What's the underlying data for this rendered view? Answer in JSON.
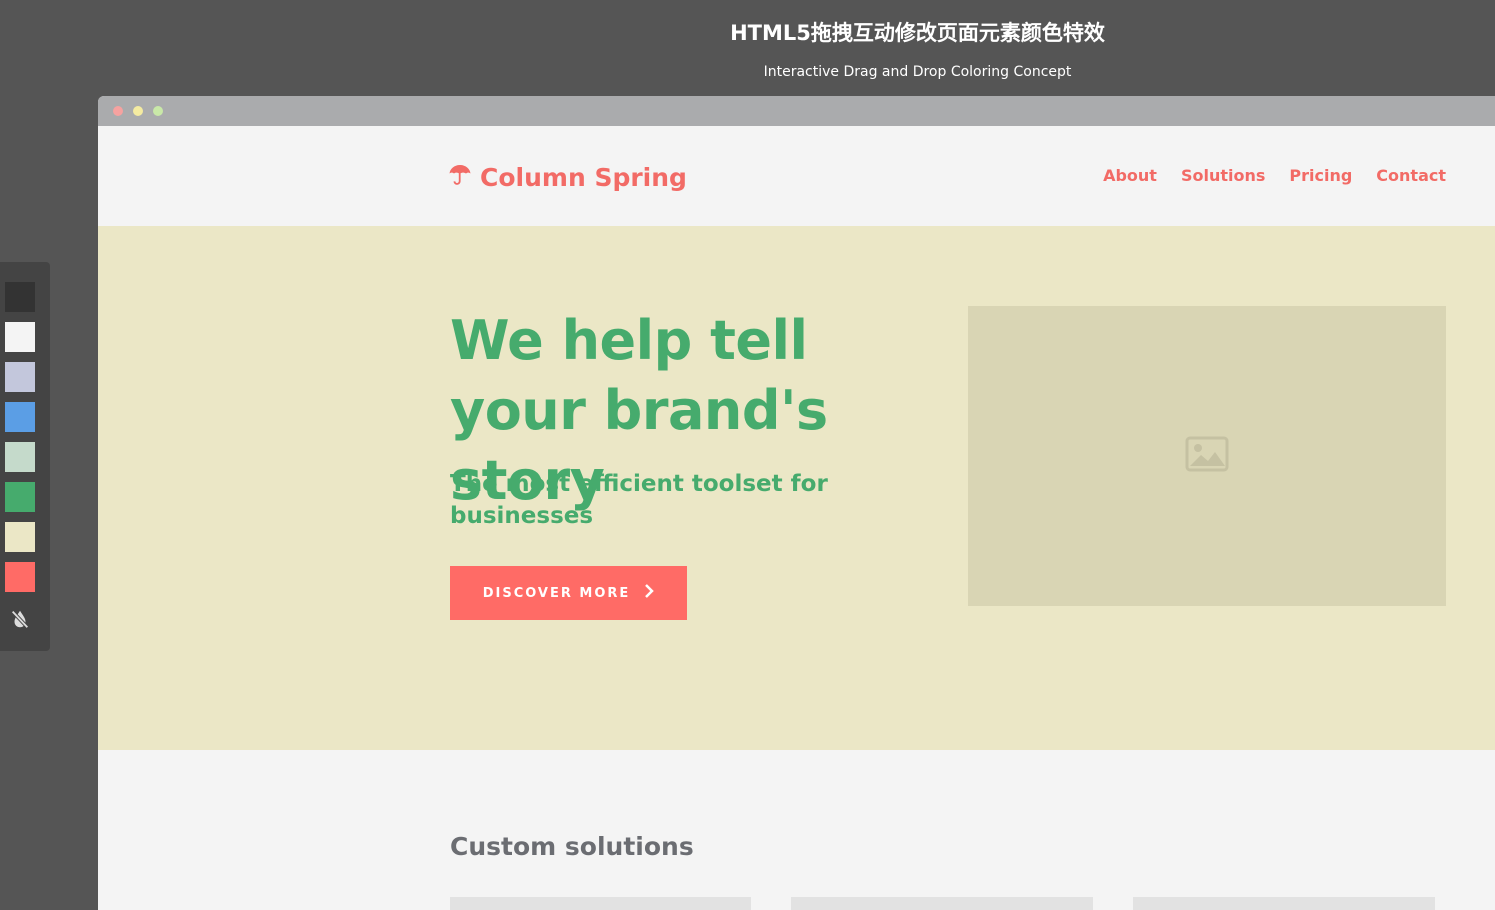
{
  "header": {
    "title": "HTML5拖拽互动修改页面元素颜色特效",
    "subtitle": "Interactive Drag and Drop Coloring Concept"
  },
  "site": {
    "logo_text": "Column Spring",
    "logo_icon": "umbrella-icon",
    "nav": [
      "About",
      "Solutions",
      "Pricing",
      "Contact"
    ]
  },
  "hero": {
    "title": "We help tell your brand's story",
    "subtitle": "The most efficient toolset for businesses",
    "cta_label": "DISCOVER MORE",
    "cta_icon": "chevron-right-icon",
    "image_icon": "image-placeholder-icon"
  },
  "section": {
    "title": "Custom solutions"
  },
  "palette": {
    "swatches": [
      "#333333",
      "#f4f4f4",
      "#c3c7dc",
      "#5b9ee5",
      "#c5dacb",
      "#46ab6d",
      "#ebe7c6",
      "#ff6b66"
    ],
    "tool_icon": "no-drop-icon"
  },
  "colors": {
    "accent": "#f26b66",
    "green": "#46ab6d",
    "hero_bg": "#ebe7c6",
    "page_bg": "#555555"
  }
}
